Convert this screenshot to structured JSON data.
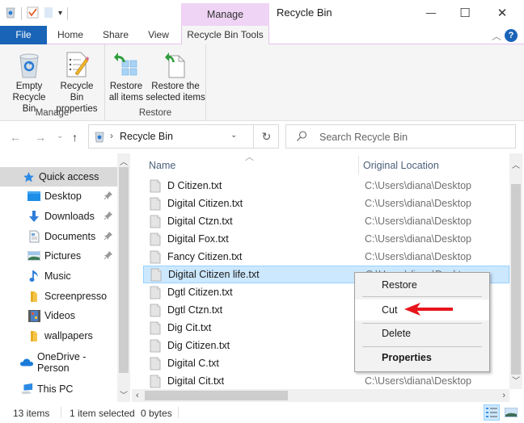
{
  "window": {
    "title": "Recycle Bin",
    "contextual_tab_group": "Manage",
    "controls": {
      "minimize": "—",
      "maximize": "☐",
      "close": "✕"
    }
  },
  "tabs": [
    {
      "label": "File",
      "state": "file"
    },
    {
      "label": "Home"
    },
    {
      "label": "Share"
    },
    {
      "label": "View"
    },
    {
      "label": "Recycle Bin Tools",
      "state": "active"
    }
  ],
  "ribbon": {
    "groups": [
      {
        "label": "Manage",
        "buttons": [
          {
            "label": "Empty\nRecycle Bin",
            "line1": "Empty",
            "line2": "Recycle Bin",
            "icon": "recycle-bin-icon"
          },
          {
            "label": "Recycle Bin\nproperties",
            "line1": "Recycle Bin",
            "line2": "properties",
            "icon": "properties-icon"
          }
        ]
      },
      {
        "label": "Restore",
        "buttons": [
          {
            "label": "Restore\nall items",
            "line1": "Restore",
            "line2": "all items",
            "icon": "restore-all-icon"
          },
          {
            "label": "Restore the\nselected items",
            "line1": "Restore the",
            "line2": "selected items",
            "icon": "restore-selected-icon"
          }
        ]
      }
    ]
  },
  "nav": {
    "back": "←",
    "forward": "→",
    "recent": "⌄",
    "up": "↑",
    "breadcrumb": "Recycle Bin",
    "refresh": "↻",
    "search_placeholder": "Search Recycle Bin"
  },
  "sidebar": {
    "items": [
      {
        "label": "Quick access",
        "icon": "star-icon",
        "selected": true
      },
      {
        "label": "Desktop",
        "icon": "desktop-icon",
        "pinned": true
      },
      {
        "label": "Downloads",
        "icon": "downloads-icon",
        "pinned": true
      },
      {
        "label": "Documents",
        "icon": "documents-icon",
        "pinned": true
      },
      {
        "label": "Pictures",
        "icon": "pictures-icon",
        "pinned": true
      },
      {
        "label": "Music",
        "icon": "music-icon"
      },
      {
        "label": "Screenpresso",
        "icon": "folder-icon"
      },
      {
        "label": "Videos",
        "icon": "videos-icon"
      },
      {
        "label": "wallpapers",
        "icon": "folder-icon"
      },
      {
        "label": "OneDrive - Person",
        "icon": "onedrive-icon"
      },
      {
        "label": "This PC",
        "icon": "this-pc-icon"
      }
    ]
  },
  "filelist": {
    "columns": [
      "Name",
      "Original Location"
    ],
    "rows": [
      {
        "name": "D Citizen.txt",
        "location": "C:\\Users\\diana\\Desktop"
      },
      {
        "name": "Digital Citizen.txt",
        "location": "C:\\Users\\diana\\Desktop"
      },
      {
        "name": "Digital Ctzn.txt",
        "location": "C:\\Users\\diana\\Desktop"
      },
      {
        "name": "Digital Fox.txt",
        "location": "C:\\Users\\diana\\Desktop"
      },
      {
        "name": "Fancy Citizen.txt",
        "location": "C:\\Users\\diana\\Desktop"
      },
      {
        "name": "Digital Citizen life.txt",
        "location": "C:\\Users\\diana\\Desktop",
        "selected": true
      },
      {
        "name": "Dgtl Citizen.txt",
        "location": ""
      },
      {
        "name": "Dgtl Ctzn.txt",
        "location": ""
      },
      {
        "name": "Dig Cit.txt",
        "location": ""
      },
      {
        "name": "Dig Citizen.txt",
        "location": ""
      },
      {
        "name": "Digital C.txt",
        "location": ""
      },
      {
        "name": "Digital Cit.txt",
        "location": "C:\\Users\\diana\\Desktop"
      }
    ]
  },
  "context_menu": {
    "items": [
      {
        "label": "Restore"
      },
      {
        "label": "Cut",
        "hover": true
      },
      {
        "label": "Delete"
      },
      {
        "label": "Properties",
        "bold": true
      }
    ],
    "annotation_color": "#e8141c"
  },
  "status": {
    "item_count": "13 items",
    "selection": "1 item selected",
    "size": "0 bytes"
  },
  "colors": {
    "file_tab": "#1a64b8",
    "manage_tab": "#efd4f5",
    "selection": "#cce8ff",
    "selection_border": "#99d1ff"
  }
}
